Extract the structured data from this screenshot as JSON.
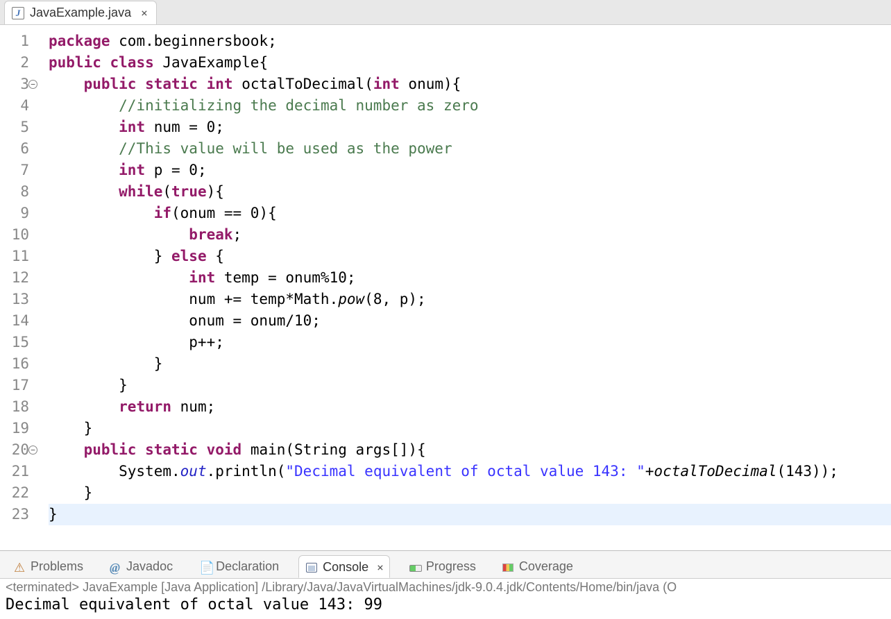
{
  "editor_tab": {
    "filename": "JavaExample.java",
    "icon_letter": "J"
  },
  "gutter": {
    "line_count": 23,
    "fold_lines": [
      3,
      20
    ],
    "method_marker_lines": [
      20,
      21,
      22
    ]
  },
  "code": {
    "tokens": [
      [
        {
          "t": "package",
          "c": "kw"
        },
        {
          "t": " com.beginnersbook;"
        }
      ],
      [
        {
          "t": "public",
          "c": "kw"
        },
        {
          "t": " "
        },
        {
          "t": "class",
          "c": "kw"
        },
        {
          "t": " JavaExample{"
        }
      ],
      [
        {
          "t": "    "
        },
        {
          "t": "public",
          "c": "kw"
        },
        {
          "t": " "
        },
        {
          "t": "static",
          "c": "kw"
        },
        {
          "t": " "
        },
        {
          "t": "int",
          "c": "kw"
        },
        {
          "t": " octalToDecimal("
        },
        {
          "t": "int",
          "c": "kw"
        },
        {
          "t": " onum){"
        }
      ],
      [
        {
          "t": "        "
        },
        {
          "t": "//initializing the decimal number as zero ",
          "c": "cm"
        }
      ],
      [
        {
          "t": "        "
        },
        {
          "t": "int",
          "c": "kw"
        },
        {
          "t": " num = 0;"
        }
      ],
      [
        {
          "t": "        "
        },
        {
          "t": "//This value will be used as the power  ",
          "c": "cm"
        }
      ],
      [
        {
          "t": "        "
        },
        {
          "t": "int",
          "c": "kw"
        },
        {
          "t": " p = 0;"
        }
      ],
      [
        {
          "t": "        "
        },
        {
          "t": "while",
          "c": "kw"
        },
        {
          "t": "("
        },
        {
          "t": "true",
          "c": "kw"
        },
        {
          "t": "){"
        }
      ],
      [
        {
          "t": "            "
        },
        {
          "t": "if",
          "c": "kw"
        },
        {
          "t": "(onum == 0){"
        }
      ],
      [
        {
          "t": "                "
        },
        {
          "t": "break",
          "c": "kw"
        },
        {
          "t": ";"
        }
      ],
      [
        {
          "t": "            } "
        },
        {
          "t": "else",
          "c": "kw"
        },
        {
          "t": " {"
        }
      ],
      [
        {
          "t": "                "
        },
        {
          "t": "int",
          "c": "kw"
        },
        {
          "t": " temp = onum%10;"
        }
      ],
      [
        {
          "t": "                num += temp*Math."
        },
        {
          "t": "pow",
          "c": "call-italic"
        },
        {
          "t": "(8, p);"
        }
      ],
      [
        {
          "t": "                onum = onum/10;"
        }
      ],
      [
        {
          "t": "                p++;"
        }
      ],
      [
        {
          "t": "            }"
        }
      ],
      [
        {
          "t": "        }"
        }
      ],
      [
        {
          "t": "        "
        },
        {
          "t": "return",
          "c": "kw"
        },
        {
          "t": " num;"
        }
      ],
      [
        {
          "t": "    }"
        }
      ],
      [
        {
          "t": "    "
        },
        {
          "t": "public",
          "c": "kw"
        },
        {
          "t": " "
        },
        {
          "t": "static",
          "c": "kw"
        },
        {
          "t": " "
        },
        {
          "t": "void",
          "c": "kw"
        },
        {
          "t": " main(String args[]){"
        }
      ],
      [
        {
          "t": "        System."
        },
        {
          "t": "out",
          "c": "static-mem"
        },
        {
          "t": ".println("
        },
        {
          "t": "\"Decimal equivalent of octal value 143: \"",
          "c": "str"
        },
        {
          "t": "+"
        },
        {
          "t": "octalToDecimal",
          "c": "call-italic"
        },
        {
          "t": "(143));"
        }
      ],
      [
        {
          "t": "    }"
        }
      ],
      [
        {
          "t": "}"
        }
      ]
    ],
    "current_line": 23
  },
  "bottom_tabs": {
    "items": [
      {
        "id": "problems",
        "label": "Problems"
      },
      {
        "id": "javadoc",
        "label": "Javadoc"
      },
      {
        "id": "declaration",
        "label": "Declaration"
      },
      {
        "id": "console",
        "label": "Console"
      },
      {
        "id": "progress",
        "label": "Progress"
      },
      {
        "id": "coverage",
        "label": "Coverage"
      }
    ],
    "active": "console"
  },
  "console": {
    "header": "<terminated> JavaExample [Java Application] /Library/Java/JavaVirtualMachines/jdk-9.0.4.jdk/Contents/Home/bin/java (O",
    "output": "Decimal equivalent of octal value 143: 99"
  }
}
